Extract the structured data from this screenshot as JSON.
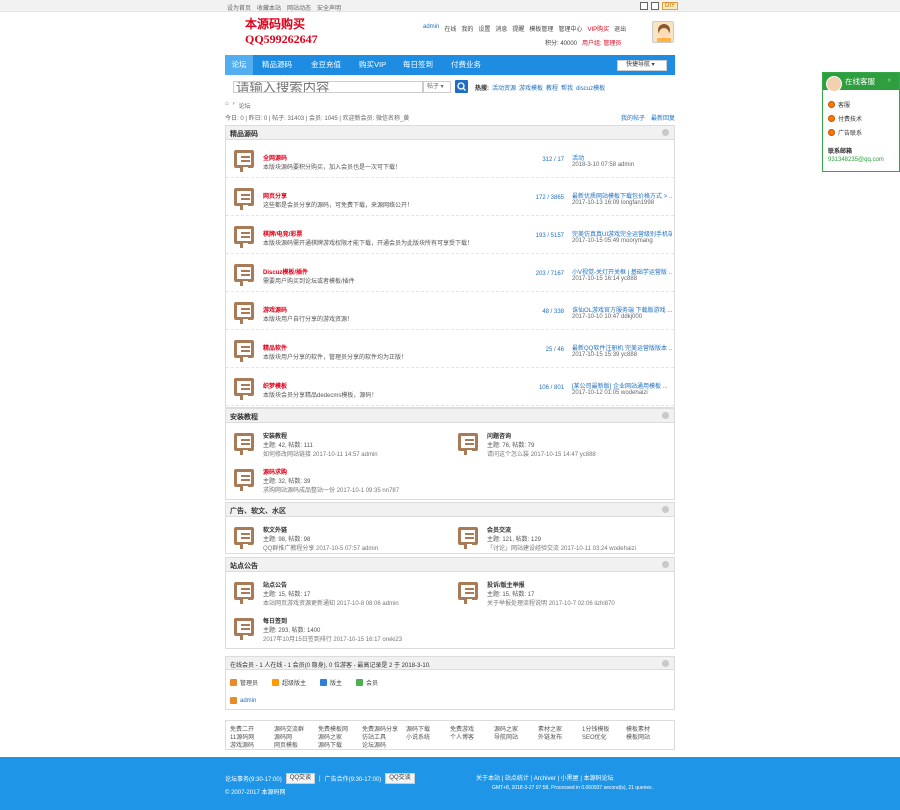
{
  "topbar": {
    "links": [
      "设为首页",
      "收藏本站",
      "网站动态",
      "安全声明"
    ],
    "diy": "DIY"
  },
  "header": {
    "logo_line1": "本源码购买",
    "logo_line2": "QQ599262647",
    "user": "admin",
    "online": "在线",
    "my": "我的",
    "settings": "设置",
    "message": "消息",
    "remind": "提醒",
    "template": "模板管理",
    "admin_center": "管理中心",
    "vip": "VIP购买",
    "exit": "退出",
    "points": "积分: 40000",
    "group": "用户组: 管理员"
  },
  "nav": {
    "items": [
      "论坛",
      "精品源码",
      "金豆充值",
      "购买VIP",
      "每日签到",
      "付费业务"
    ],
    "quick": "快捷导航"
  },
  "search": {
    "placeholder": "请输入搜索内容",
    "select": "帖子",
    "hot_label": "热搜:",
    "hot": [
      "活动资源",
      "游戏模板",
      "教程",
      "帮我",
      "discuz模板"
    ]
  },
  "crumb": [
    "论坛"
  ],
  "stats": {
    "left": "今日: 0  |  昨日: 0  |  帖子: 31403  |  会员: 1045  |  欢迎新会员: 微信名称_黄",
    "right": [
      "我的帖子",
      "最新回复"
    ]
  },
  "cats": [
    {
      "title": "精品源码",
      "forums": [
        {
          "name": "全网源码",
          "desc": "本版块源码要积分购买，加入会员也是一次可下载！",
          "count": "312 / 17",
          "last1": "活动",
          "last2": "2018-3-10 07:58 admin"
        },
        {
          "name": "网页分享",
          "desc": "这些都是会员分享的源码，可免费下载，来源网络公开！",
          "count": "172 / 3865",
          "last1": "最新优质网站模板下载包价格方式 > ...",
          "last2": "2017-10-13 16:09 longfan1998"
        },
        {
          "name": "棋牌/电竞/彩票",
          "desc": "本版块源码需开通棋牌游戏权限才能下载，开通会员为此版块所有可享受下载！",
          "count": "193 / 5157",
          "last1": "完美仿真真UI游戏完全运营级别手机端 带 ...",
          "last2": "2017-10-15 05:49 moorymang"
        },
        {
          "name": "Discuz模板/插件",
          "desc": "需要用户购买到论坛或者模板/插件",
          "count": "203 / 7167",
          "last1": "小V视觉-关灯开关框 | 基础学运营版 ...",
          "last2": "2017-10-15 16:14 yc888"
        },
        {
          "name": "游戏源码",
          "desc": "本版块用户自行分享的游戏资源！",
          "count": "48 / 338",
          "last1": "诛仙OL游戏官方服务端 下载版游戏 ...",
          "last2": "2017-10-10 10:47 ddkj000"
        },
        {
          "name": "精品软件",
          "desc": "本版块用户分享的软件，管理员分享的软件均为正版！",
          "count": "25 / 46",
          "last1": "最新QQ软件注册机 完美运营版版本 ...",
          "last2": "2017-10-15 15:39 yc888"
        },
        {
          "name": "织梦模板",
          "desc": "本版块会员分享精品dedecms模板，源码！",
          "count": "106 / 801",
          "last1": "[某公司最新版] 企业网站通用模板 ...",
          "last2": "2017-10-12 01:05 wodehaizi"
        }
      ]
    },
    {
      "title": "安装教程",
      "cells": [
        {
          "name": "安装教程",
          "stats": "主题: 42, 帖数: 111",
          "lp": "如何修改网站链接",
          "lp2": "2017-10-11 14:57 admin"
        },
        {
          "name": "问题咨询",
          "stats": "主题: 76, 帖数: 79",
          "lp": "请问这个怎么装",
          "lp2": "2017-10-15 14:47 yc888"
        },
        {
          "name": "源码求购",
          "stats": "主题: 32, 帖数: 39",
          "lp": "求购网站源码成品整站一份",
          "lp2": "2017-10-1 09:35 nn787",
          "red": true
        }
      ]
    },
    {
      "title": "广告、软文、水区",
      "cells": [
        {
          "name": "软文外链",
          "stats": "主题: 98, 帖数: 98",
          "lp": "QQ群推广教程分享",
          "lp2": "2017-10-5 07:57 admin"
        },
        {
          "name": "会员交流",
          "stats": "主题: 121, 帖数: 129",
          "lp": "「讨论」网站建设经验交流",
          "lp2": "2017-10-11 03:24 wodehaizi"
        }
      ]
    },
    {
      "title": "站点公告",
      "cells": [
        {
          "name": "站点公告",
          "stats": "主题: 15, 帖数: 17",
          "lp": "本站网页游戏资源更新通知",
          "lp2": "2017-10-8 08:06 admin"
        },
        {
          "name": "投诉/版主举报",
          "stats": "主题: 15, 帖数: 17",
          "lp": "关于举报处理流程说明",
          "lp2": "2017-10-7 02:06 lizhi870"
        },
        {
          "name": "每日签到",
          "stats": "主题: 293, 帖数: 1400",
          "lp": "2017年10月15日签到排行",
          "lp2": "2017-10-15 16:17 oreki23"
        }
      ]
    }
  ],
  "online": {
    "title": "在线会员 - 1 人在线 - 1 会员(0 隐身), 0 位游客 - 最高记录是 2 于 2018-3-10.",
    "legend": [
      "管理员",
      "超级版主",
      "版主",
      "会员"
    ],
    "legend_colors": [
      "#e88a2a",
      "#ff9900",
      "#2f7fd8",
      "#4caf50"
    ],
    "user": "admin"
  },
  "links": [
    "免费二开",
    "源码交流群",
    "免费模板网",
    "免费源码分享",
    "源码下载",
    "免费游戏",
    "源码之家",
    "素材之家",
    "1分钱模板",
    "模板素材",
    "11源码网",
    "源码网",
    "源码之家",
    "仿站工具",
    "小说系统",
    "个人博客",
    "导航网站",
    "外链发布",
    "SEO优化",
    "模板网站",
    "游戏源码",
    "网页模板",
    "源码下载",
    "论坛源码"
  ],
  "footer": {
    "contact1": "论坛事务(9:30-17:00)",
    "qq1": "QQ交谈",
    "contact2": "广告合作(9:30-17:00)",
    "qq2": "QQ交谈",
    "copyright": "© 2007-2017 本源码网",
    "right_links": "关于本站 | 站点统计 | Archiver | 小黑屋 | 本源码论坛",
    "right_info": "GMT+8, 2018-3-27 07:58, Processed in 0.060937 second(s), 21 queries ."
  },
  "side": {
    "title": "在线客服",
    "items": [
      "客服",
      "付费技术",
      "广告联系"
    ],
    "email_label": "联系邮箱",
    "email": "931348235@qq.com"
  }
}
